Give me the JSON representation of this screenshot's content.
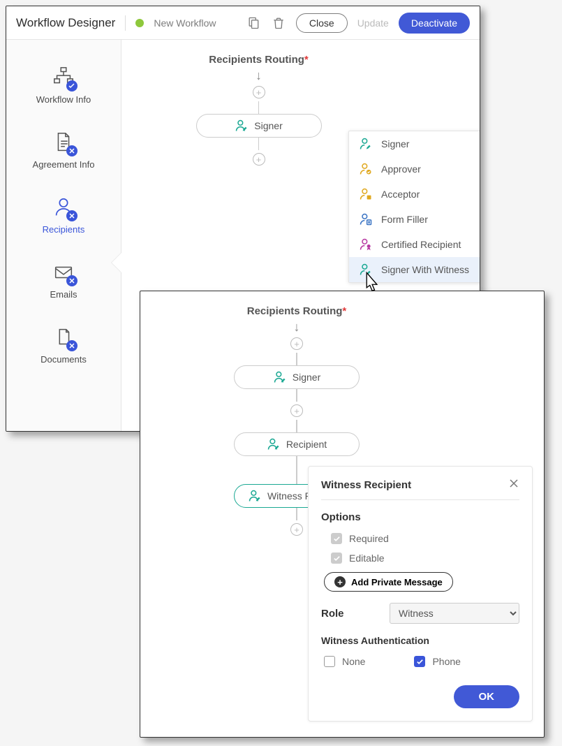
{
  "header": {
    "title": "Workflow Designer",
    "status": "New Workflow",
    "close": "Close",
    "update": "Update",
    "deactivate": "Deactivate"
  },
  "sidebar": {
    "items": [
      {
        "label": "Workflow Info"
      },
      {
        "label": "Agreement Info"
      },
      {
        "label": "Recipients"
      },
      {
        "label": "Emails"
      },
      {
        "label": "Documents"
      }
    ]
  },
  "routing": {
    "title": "Recipients Routing",
    "node1": "Signer"
  },
  "dropdown": {
    "items": [
      {
        "label": "Signer",
        "color": "#1aa893"
      },
      {
        "label": "Approver",
        "color": "#e0a81e"
      },
      {
        "label": "Acceptor",
        "color": "#e0a81e"
      },
      {
        "label": "Form Filler",
        "color": "#3a74c4"
      },
      {
        "label": "Certified Recipient",
        "color": "#b83aa3"
      },
      {
        "label": "Signer With Witness",
        "color": "#1aa893"
      }
    ]
  },
  "routing2": {
    "title": "Recipients Routing",
    "node1": "Signer",
    "node2": "Recipient",
    "node3": "Witness Recipient"
  },
  "props": {
    "title": "Witness Recipient",
    "options_label": "Options",
    "required": "Required",
    "editable": "Editable",
    "add_msg": "Add Private Message",
    "role_label": "Role",
    "role_value": "Witness",
    "auth_label": "Witness Authentication",
    "auth_none": "None",
    "auth_phone": "Phone",
    "ok": "OK"
  }
}
